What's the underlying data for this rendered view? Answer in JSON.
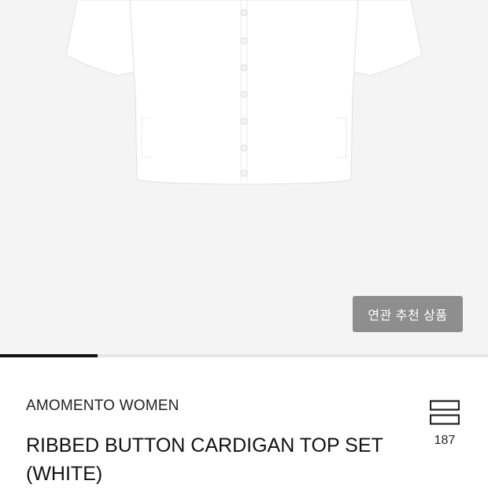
{
  "gallery": {
    "related_button_label": "연관 추천 상품",
    "slide_progress": 0.2
  },
  "product": {
    "brand": "AMOMENTO WOMEN",
    "title": "RIBBED BUTTON CARDIGAN TOP SET (WHITE)",
    "wish_count": "187",
    "wish_icon": "bookmark-stack-icon"
  },
  "colors": {
    "hero_bg": "#f4f4f4",
    "button_bg": "#8e8e8e",
    "progress_fill": "#111111"
  }
}
